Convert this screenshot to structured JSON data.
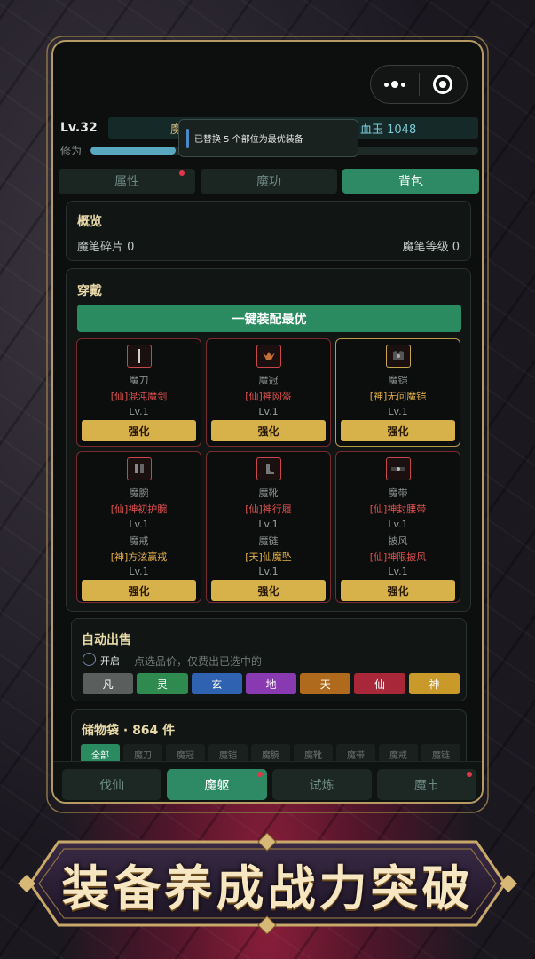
{
  "header": {
    "level": "Lv.32",
    "stat_left": "魔",
    "stat_right": "血玉 1048",
    "xp_label": "修为",
    "xp_progress_percent": 22
  },
  "toast": {
    "message": "已替换 5 个部位为最优装备"
  },
  "tabs": [
    {
      "label": "属性"
    },
    {
      "label": "魔功"
    },
    {
      "label": "背包"
    }
  ],
  "overview": {
    "title": "概览",
    "fragments": "魔笔碎片 0",
    "level": "魔笔等级 0"
  },
  "equip": {
    "title": "穿戴",
    "best_button": "一键装配最优",
    "strengthen_label": "强化",
    "slots": [
      {
        "type": "魔刀",
        "name": "[仙]混沌魔剑",
        "level": "Lv.1"
      },
      {
        "type": "魔冠",
        "name": "[仙]神网盔",
        "level": "Lv.1"
      },
      {
        "type": "魔铠",
        "name": "[神]无问魔铠",
        "level": "Lv.1"
      },
      {
        "type": "魔腕",
        "name": "[仙]神初护腕",
        "level": "Lv.1",
        "type2": "魔戒",
        "name2": "[神]方泫赢戒",
        "level2": "Lv.1"
      },
      {
        "type": "魔靴",
        "name": "[仙]神行履",
        "level": "Lv.1",
        "type2": "魔链",
        "name2": "[天]仙魔坠",
        "level2": "Lv.1"
      },
      {
        "type": "魔带",
        "name": "[仙]神封腰带",
        "level": "Lv.1",
        "type2": "披风",
        "name2": "[仙]神限披风",
        "level2": "Lv.1"
      }
    ]
  },
  "autosell": {
    "title": "自动出售",
    "open_label": "开启",
    "hint": "点选品价，仅费出已选中的",
    "grades": [
      {
        "label": "凡",
        "color": "#5a5f5d"
      },
      {
        "label": "灵",
        "color": "#2e8a4f"
      },
      {
        "label": "玄",
        "color": "#2f62b0"
      },
      {
        "label": "地",
        "color": "#8a3ab0"
      },
      {
        "label": "天",
        "color": "#b06a1e"
      },
      {
        "label": "仙",
        "color": "#a8283a"
      },
      {
        "label": "神",
        "color": "#c99a2a"
      }
    ]
  },
  "bag": {
    "title": "储物袋 · 864 件",
    "tabs": [
      "全部",
      "魔刀",
      "魔冠",
      "魔铠",
      "魔腕",
      "魔靴",
      "魔带",
      "魔戒",
      "魔链"
    ]
  },
  "bottom_nav": [
    {
      "label": "伐仙"
    },
    {
      "label": "魔躯"
    },
    {
      "label": "试炼"
    },
    {
      "label": "魔市"
    }
  ],
  "banner": {
    "text": "装备养成战力突破"
  }
}
